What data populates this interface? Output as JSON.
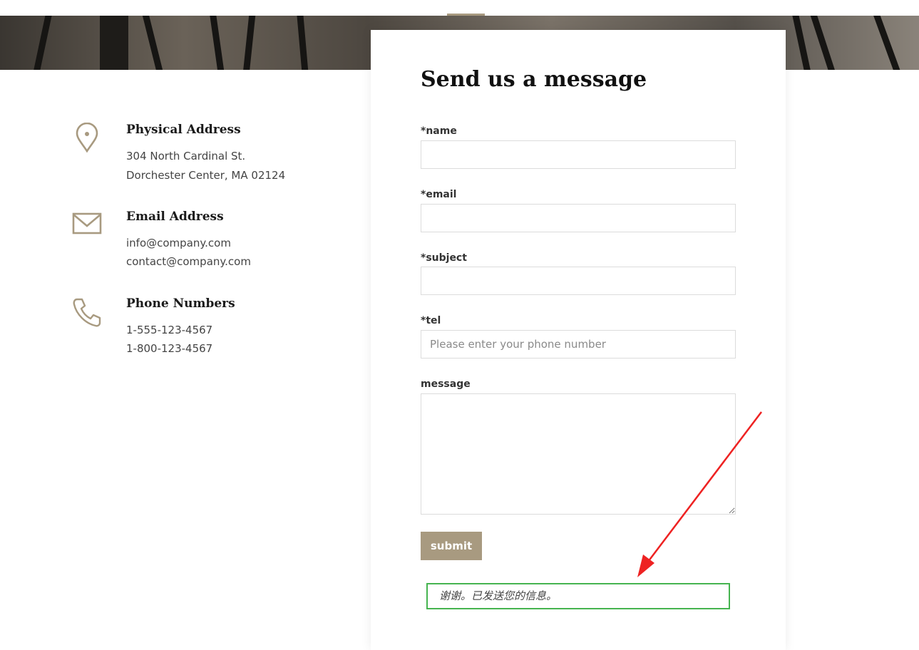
{
  "contact_info": [
    {
      "icon": "location-pin-icon",
      "title": "Physical Address",
      "lines": [
        "304 North Cardinal St.",
        "Dorchester Center, MA 02124"
      ]
    },
    {
      "icon": "envelope-icon",
      "title": "Email Address",
      "lines": [
        "info@company.com",
        "contact@company.com"
      ]
    },
    {
      "icon": "phone-icon",
      "title": "Phone Numbers",
      "lines": [
        "1-555-123-4567",
        "1-800-123-4567"
      ]
    }
  ],
  "form": {
    "title": "Send us a message",
    "name_label": "*name",
    "email_label": "*email",
    "subject_label": "*subject",
    "tel_label": "*tel",
    "tel_placeholder": "Please enter your phone number",
    "message_label": "message",
    "submit_label": "submit",
    "success_message": "谢谢。已发送您的信息。"
  },
  "colors": {
    "accent": "#a89a80",
    "success_border": "#46b450",
    "annotation_arrow": "#ee2222"
  }
}
